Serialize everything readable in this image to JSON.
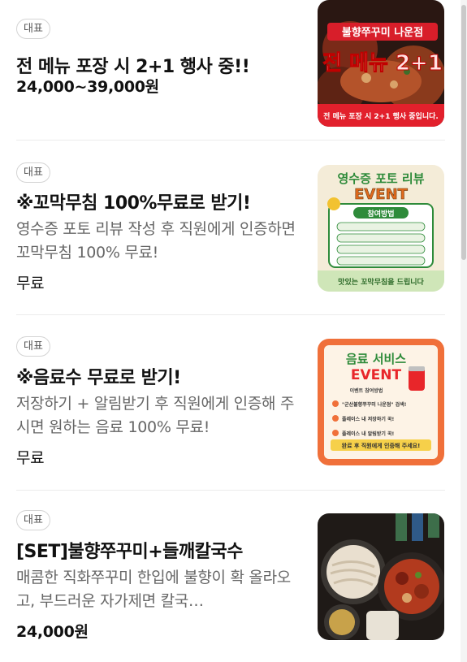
{
  "menu": {
    "items": [
      {
        "badge": "대표",
        "title": "전 메뉴 포장 시 2+1 행사 중!!",
        "description": "",
        "price": "24,000~39,000원",
        "image": {
          "line1": "불향쭈꾸미 나운점",
          "line2": "전 메뉴 2+1",
          "footer": "전 메뉴 포장 시 2+1 행사 중입니다."
        }
      },
      {
        "badge": "대표",
        "title": "※꼬막무침 100%무료로 받기!",
        "description": "영수증 포토 리뷰 작성 후 직원에게 인증하면 꼬막무침 100% 무료!",
        "price": "무료",
        "image": {
          "line1": "영수증 포토 리뷰",
          "line2": "EVENT",
          "header": "참여방법",
          "footer": "맛있는 꼬막무침을 드립니다"
        }
      },
      {
        "badge": "대표",
        "title": "※음료수 무료로 받기!",
        "description": "저장하기 + 알림받기 후 직원에게 인증해 주시면 원하는 음료 100% 무료!",
        "price": "무료",
        "image": {
          "line1": "음료 서비스",
          "line2": "EVENT",
          "header": "이벤트 참여방법",
          "step1": "\"군산불향쭈꾸미 나운점\" 검색!",
          "step2": "플레이스 내 저장하기 꾹!",
          "step3": "플레이스 내 알림받기 꾹!",
          "footer": "완료 후 직원에게 인증해 주세요!"
        }
      },
      {
        "badge": "대표",
        "title": "[SET]불향쭈꾸미+들깨칼국수",
        "description": "매콤한 직화쭈꾸미 한입에 불향이 확 올라오고, 부드러운 자가제면 칼국…",
        "price": "24,000원",
        "image": {}
      }
    ]
  },
  "colors": {
    "accent_red": "#e8262a",
    "event_green": "#2e8b3a",
    "event_orange": "#f0703a",
    "divider": "#ececec"
  }
}
